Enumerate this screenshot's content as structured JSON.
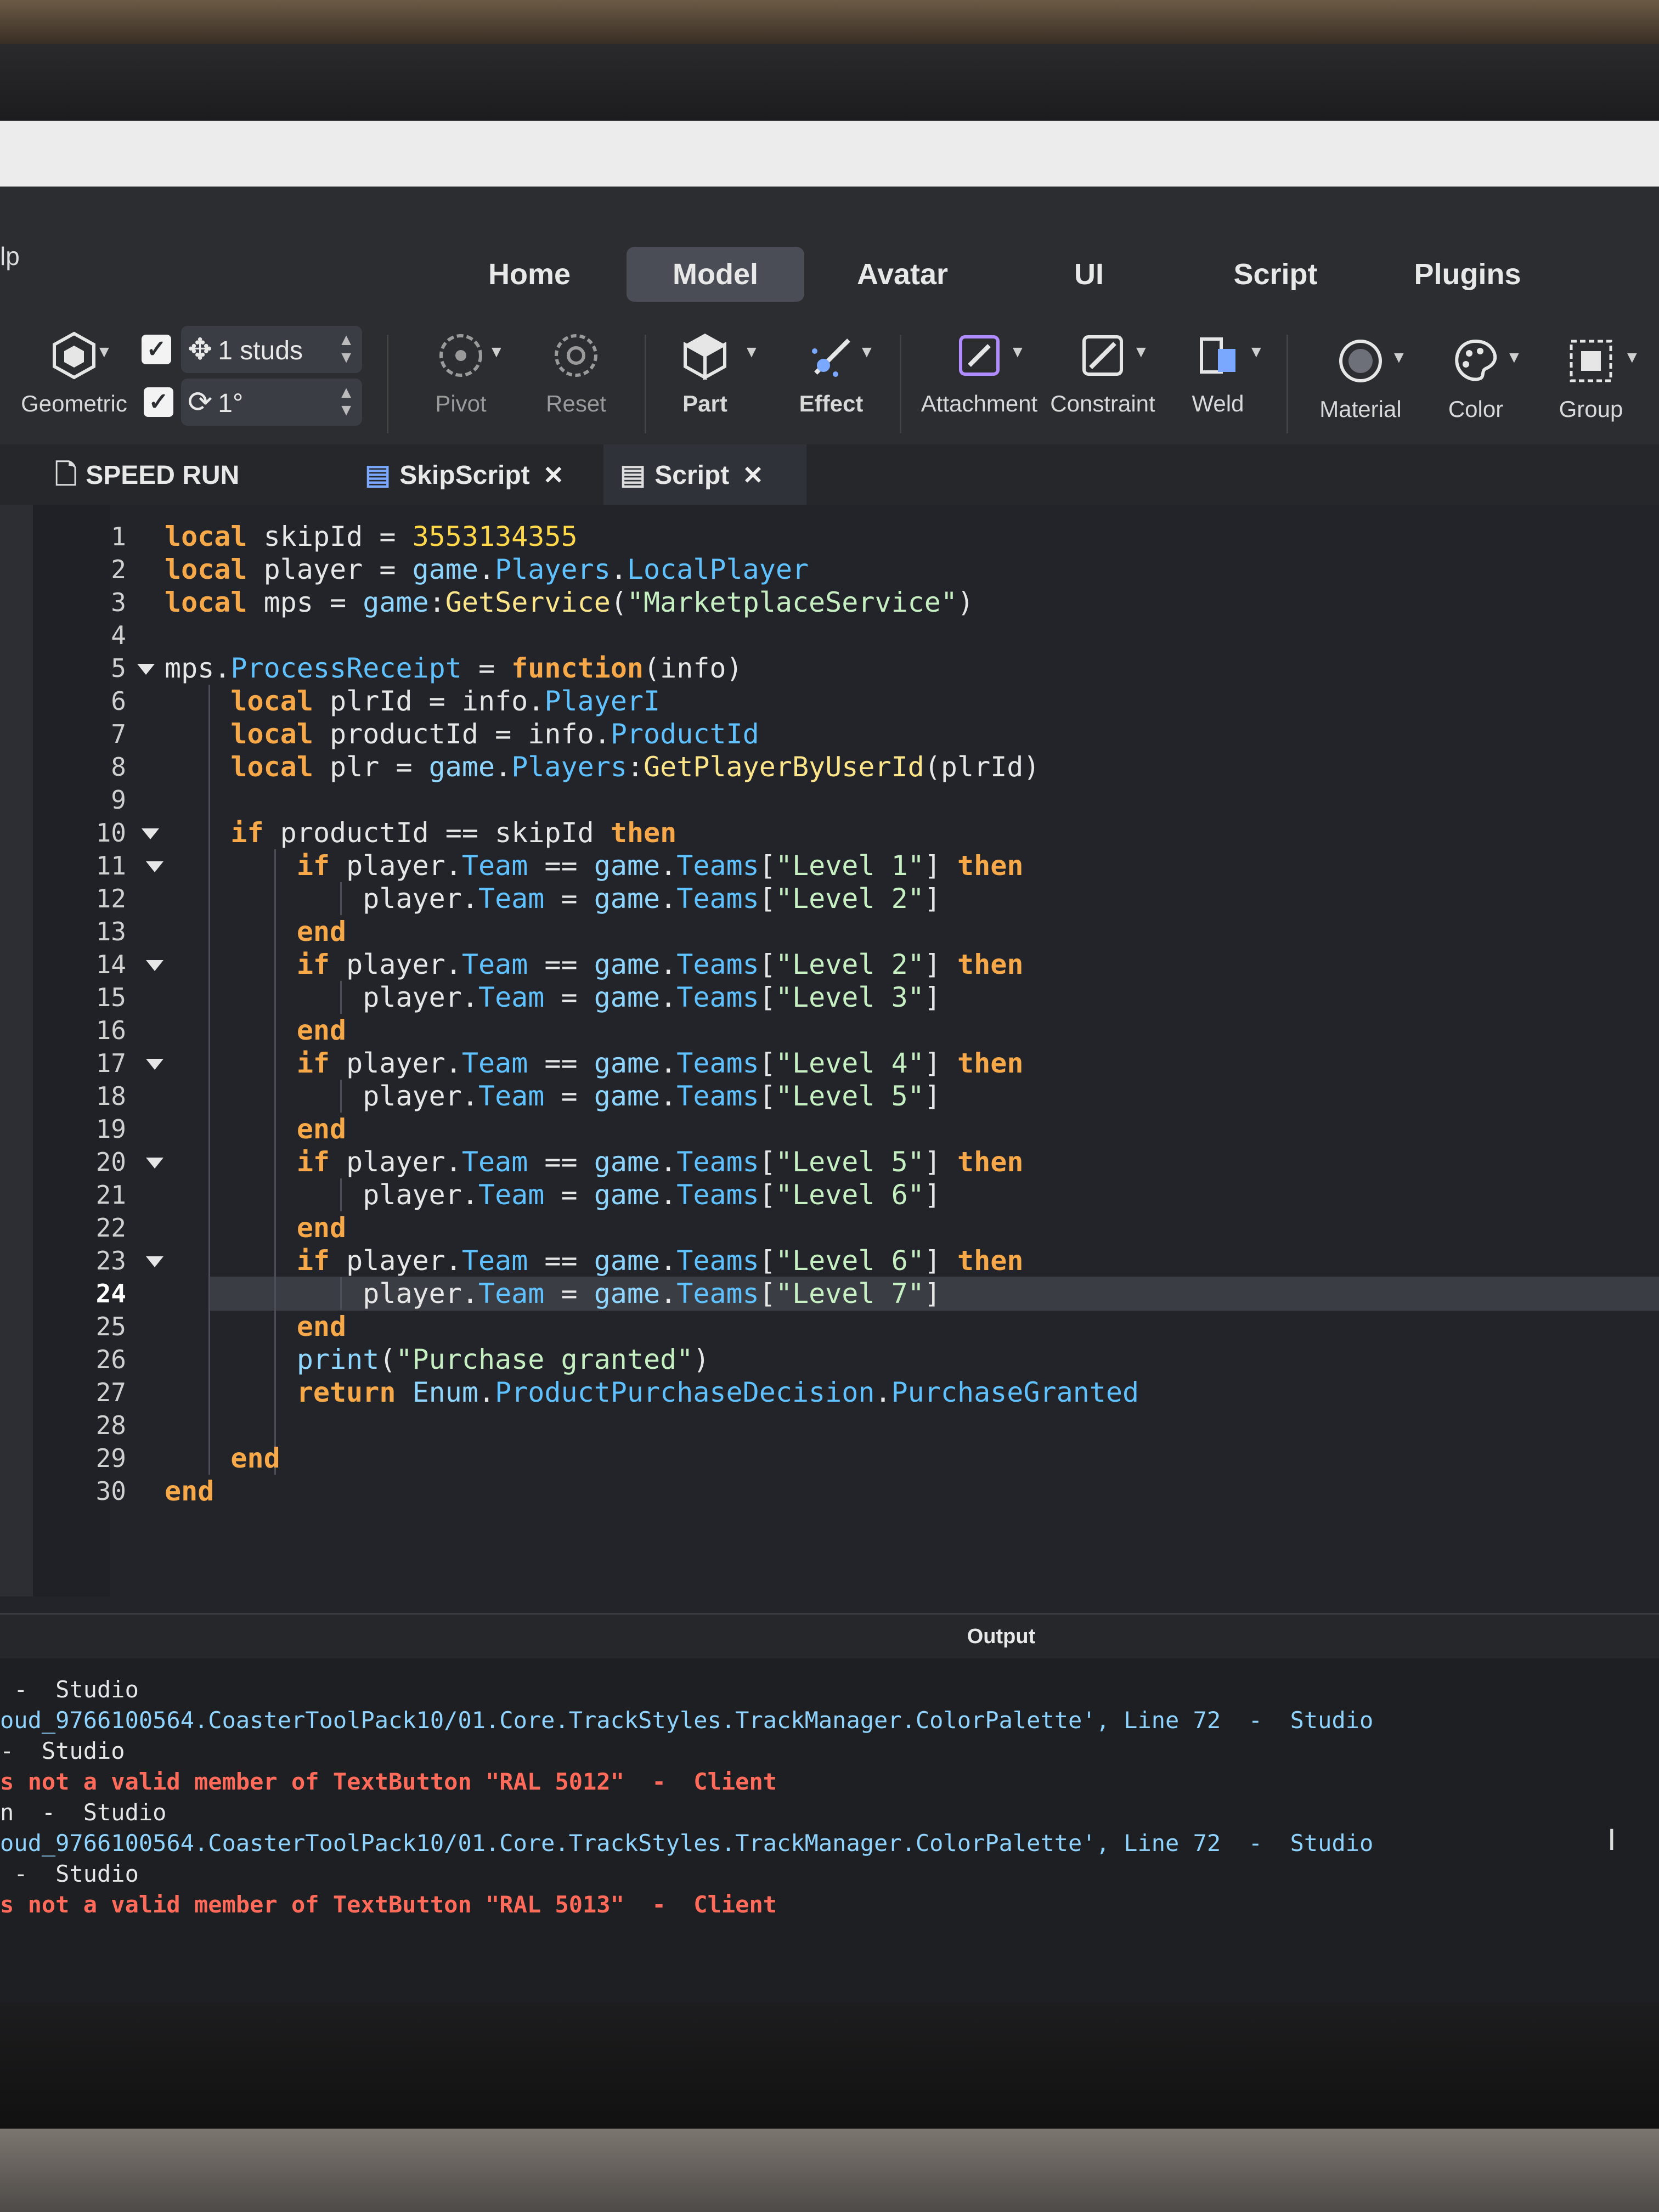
{
  "app": {
    "menu_fragment": "lp"
  },
  "ribbon_tabs": [
    "Home",
    "Model",
    "Avatar",
    "UI",
    "Script",
    "Plugins"
  ],
  "ribbon": {
    "mode_label": "Geometric",
    "move_snap": "1 studs",
    "rotate_snap": "1°",
    "pivot_label": "Pivot",
    "reset_label": "Reset",
    "part_label": "Part",
    "effect_label": "Effect",
    "attachment_label": "Attachment",
    "constraint_label": "Constraint",
    "weld_label": "Weld",
    "material_label": "Material",
    "color_label": "Color",
    "group_label": "Group",
    "check_mark": "✓"
  },
  "editor_tabs": [
    {
      "label": "SPEED RUN WIP",
      "close": "✕"
    },
    {
      "label": "SkipScript",
      "close": "✕"
    },
    {
      "label": "Script",
      "close": "✕"
    }
  ],
  "editor": {
    "current_line": 24,
    "line_numbers": [
      "1",
      "2",
      "3",
      "4",
      "5",
      "6",
      "7",
      "8",
      "9",
      "10",
      "11",
      "12",
      "13",
      "14",
      "15",
      "16",
      "17",
      "18",
      "19",
      "20",
      "21",
      "22",
      "23",
      "24",
      "25",
      "26",
      "27",
      "28",
      "29",
      "30"
    ],
    "code": [
      "local skipId = 3553134355",
      "local player = game.Players.LocalPlayer",
      "local mps = game:GetService(\"MarketplaceService\")",
      "",
      "mps.ProcessReceipt = function(info)",
      "    local plrId = info.PlayerI",
      "    local productId = info.ProductId",
      "    local plr = game.Players:GetPlayerByUserId(plrId)",
      "",
      "    if productId == skipId then",
      "        if player.Team == game.Teams[\"Level 1\"] then",
      "            player.Team = game.Teams[\"Level 2\"]",
      "        end",
      "        if player.Team == game.Teams[\"Level 2\"] then",
      "            player.Team = game.Teams[\"Level 3\"]",
      "        end",
      "        if player.Team == game.Teams[\"Level 4\"] then",
      "            player.Team = game.Teams[\"Level 5\"]",
      "        end",
      "        if player.Team == game.Teams[\"Level 5\"] then",
      "            player.Team = game.Teams[\"Level 6\"]",
      "        end",
      "        if player.Team == game.Teams[\"Level 6\"] then",
      "            player.Team = game.Teams[\"Level 7\"]",
      "        end",
      "        print(\"Purchase granted\")",
      "        return Enum.ProductPurchaseDecision.PurchaseGranted",
      "",
      "    end",
      "end"
    ]
  },
  "output": {
    "title": "Output",
    "lines": [
      {
        "text": " -  Studio",
        "kind": "normal"
      },
      {
        "text": "oud_9766100564.CoasterToolPack10/01.Core.TrackStyles.TrackManager.ColorPalette', Line 72  -  Studio",
        "kind": "link"
      },
      {
        "text": "-  Studio",
        "kind": "normal"
      },
      {
        "text": "s not a valid member of TextButton \"RAL 5012\"  -  Client",
        "kind": "warn"
      },
      {
        "text": "n  -  Studio",
        "kind": "normal"
      },
      {
        "text": "oud_9766100564.CoasterToolPack10/01.Core.TrackStyles.TrackManager.ColorPalette', Line 72  -  Studio",
        "kind": "link"
      },
      {
        "text": " -  Studio",
        "kind": "normal"
      },
      {
        "text": "s not a valid member of TextButton \"RAL 5013\"  -  Client",
        "kind": "warn"
      }
    ]
  },
  "colors": {
    "keyword": "#f7a848",
    "number": "#ffd84a",
    "string": "#c6f0c2",
    "property": "#5fc2ff",
    "function": "#fde68a",
    "warning": "#ff6b5a"
  }
}
